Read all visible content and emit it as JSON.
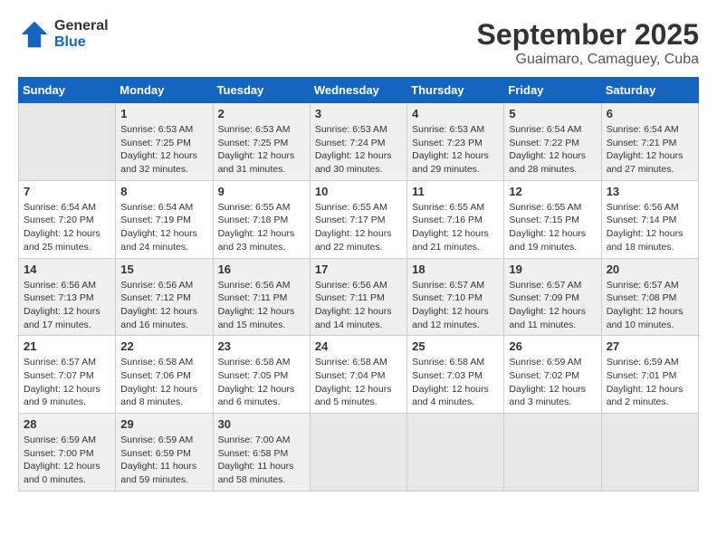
{
  "logo": {
    "general": "General",
    "blue": "Blue"
  },
  "header": {
    "month": "September 2025",
    "location": "Guaimaro, Camaguey, Cuba"
  },
  "weekdays": [
    "Sunday",
    "Monday",
    "Tuesday",
    "Wednesday",
    "Thursday",
    "Friday",
    "Saturday"
  ],
  "weeks": [
    [
      {
        "day": "",
        "sunrise": "",
        "sunset": "",
        "daylight": ""
      },
      {
        "day": "1",
        "sunrise": "Sunrise: 6:53 AM",
        "sunset": "Sunset: 7:25 PM",
        "daylight": "Daylight: 12 hours and 32 minutes."
      },
      {
        "day": "2",
        "sunrise": "Sunrise: 6:53 AM",
        "sunset": "Sunset: 7:25 PM",
        "daylight": "Daylight: 12 hours and 31 minutes."
      },
      {
        "day": "3",
        "sunrise": "Sunrise: 6:53 AM",
        "sunset": "Sunset: 7:24 PM",
        "daylight": "Daylight: 12 hours and 30 minutes."
      },
      {
        "day": "4",
        "sunrise": "Sunrise: 6:53 AM",
        "sunset": "Sunset: 7:23 PM",
        "daylight": "Daylight: 12 hours and 29 minutes."
      },
      {
        "day": "5",
        "sunrise": "Sunrise: 6:54 AM",
        "sunset": "Sunset: 7:22 PM",
        "daylight": "Daylight: 12 hours and 28 minutes."
      },
      {
        "day": "6",
        "sunrise": "Sunrise: 6:54 AM",
        "sunset": "Sunset: 7:21 PM",
        "daylight": "Daylight: 12 hours and 27 minutes."
      }
    ],
    [
      {
        "day": "7",
        "sunrise": "Sunrise: 6:54 AM",
        "sunset": "Sunset: 7:20 PM",
        "daylight": "Daylight: 12 hours and 25 minutes."
      },
      {
        "day": "8",
        "sunrise": "Sunrise: 6:54 AM",
        "sunset": "Sunset: 7:19 PM",
        "daylight": "Daylight: 12 hours and 24 minutes."
      },
      {
        "day": "9",
        "sunrise": "Sunrise: 6:55 AM",
        "sunset": "Sunset: 7:18 PM",
        "daylight": "Daylight: 12 hours and 23 minutes."
      },
      {
        "day": "10",
        "sunrise": "Sunrise: 6:55 AM",
        "sunset": "Sunset: 7:17 PM",
        "daylight": "Daylight: 12 hours and 22 minutes."
      },
      {
        "day": "11",
        "sunrise": "Sunrise: 6:55 AM",
        "sunset": "Sunset: 7:16 PM",
        "daylight": "Daylight: 12 hours and 21 minutes."
      },
      {
        "day": "12",
        "sunrise": "Sunrise: 6:55 AM",
        "sunset": "Sunset: 7:15 PM",
        "daylight": "Daylight: 12 hours and 19 minutes."
      },
      {
        "day": "13",
        "sunrise": "Sunrise: 6:56 AM",
        "sunset": "Sunset: 7:14 PM",
        "daylight": "Daylight: 12 hours and 18 minutes."
      }
    ],
    [
      {
        "day": "14",
        "sunrise": "Sunrise: 6:56 AM",
        "sunset": "Sunset: 7:13 PM",
        "daylight": "Daylight: 12 hours and 17 minutes."
      },
      {
        "day": "15",
        "sunrise": "Sunrise: 6:56 AM",
        "sunset": "Sunset: 7:12 PM",
        "daylight": "Daylight: 12 hours and 16 minutes."
      },
      {
        "day": "16",
        "sunrise": "Sunrise: 6:56 AM",
        "sunset": "Sunset: 7:11 PM",
        "daylight": "Daylight: 12 hours and 15 minutes."
      },
      {
        "day": "17",
        "sunrise": "Sunrise: 6:56 AM",
        "sunset": "Sunset: 7:11 PM",
        "daylight": "Daylight: 12 hours and 14 minutes."
      },
      {
        "day": "18",
        "sunrise": "Sunrise: 6:57 AM",
        "sunset": "Sunset: 7:10 PM",
        "daylight": "Daylight: 12 hours and 12 minutes."
      },
      {
        "day": "19",
        "sunrise": "Sunrise: 6:57 AM",
        "sunset": "Sunset: 7:09 PM",
        "daylight": "Daylight: 12 hours and 11 minutes."
      },
      {
        "day": "20",
        "sunrise": "Sunrise: 6:57 AM",
        "sunset": "Sunset: 7:08 PM",
        "daylight": "Daylight: 12 hours and 10 minutes."
      }
    ],
    [
      {
        "day": "21",
        "sunrise": "Sunrise: 6:57 AM",
        "sunset": "Sunset: 7:07 PM",
        "daylight": "Daylight: 12 hours and 9 minutes."
      },
      {
        "day": "22",
        "sunrise": "Sunrise: 6:58 AM",
        "sunset": "Sunset: 7:06 PM",
        "daylight": "Daylight: 12 hours and 8 minutes."
      },
      {
        "day": "23",
        "sunrise": "Sunrise: 6:58 AM",
        "sunset": "Sunset: 7:05 PM",
        "daylight": "Daylight: 12 hours and 6 minutes."
      },
      {
        "day": "24",
        "sunrise": "Sunrise: 6:58 AM",
        "sunset": "Sunset: 7:04 PM",
        "daylight": "Daylight: 12 hours and 5 minutes."
      },
      {
        "day": "25",
        "sunrise": "Sunrise: 6:58 AM",
        "sunset": "Sunset: 7:03 PM",
        "daylight": "Daylight: 12 hours and 4 minutes."
      },
      {
        "day": "26",
        "sunrise": "Sunrise: 6:59 AM",
        "sunset": "Sunset: 7:02 PM",
        "daylight": "Daylight: 12 hours and 3 minutes."
      },
      {
        "day": "27",
        "sunrise": "Sunrise: 6:59 AM",
        "sunset": "Sunset: 7:01 PM",
        "daylight": "Daylight: 12 hours and 2 minutes."
      }
    ],
    [
      {
        "day": "28",
        "sunrise": "Sunrise: 6:59 AM",
        "sunset": "Sunset: 7:00 PM",
        "daylight": "Daylight: 12 hours and 0 minutes."
      },
      {
        "day": "29",
        "sunrise": "Sunrise: 6:59 AM",
        "sunset": "Sunset: 6:59 PM",
        "daylight": "Daylight: 11 hours and 59 minutes."
      },
      {
        "day": "30",
        "sunrise": "Sunrise: 7:00 AM",
        "sunset": "Sunset: 6:58 PM",
        "daylight": "Daylight: 11 hours and 58 minutes."
      },
      {
        "day": "",
        "sunrise": "",
        "sunset": "",
        "daylight": ""
      },
      {
        "day": "",
        "sunrise": "",
        "sunset": "",
        "daylight": ""
      },
      {
        "day": "",
        "sunrise": "",
        "sunset": "",
        "daylight": ""
      },
      {
        "day": "",
        "sunrise": "",
        "sunset": "",
        "daylight": ""
      }
    ]
  ]
}
